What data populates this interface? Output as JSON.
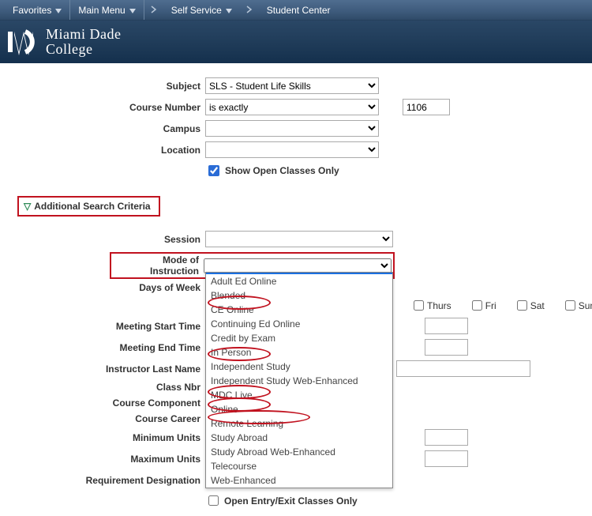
{
  "nav": {
    "favorites": "Favorites",
    "main_menu": "Main Menu",
    "self_service": "Self Service",
    "student_center": "Student Center"
  },
  "brand": {
    "line1": "Miami Dade",
    "line2": "College"
  },
  "form": {
    "subject_label": "Subject",
    "subject_value": "SLS - Student Life Skills",
    "course_number_label": "Course Number",
    "course_number_match": "is exactly",
    "course_number_value": "1106",
    "campus_label": "Campus",
    "campus_value": "",
    "location_label": "Location",
    "location_value": "",
    "show_open_label": "Show Open Classes Only"
  },
  "additional_label": "Additional Search Criteria",
  "adv": {
    "session_label": "Session",
    "moi_label": "Mode of Instruction",
    "days_label": "Days of Week",
    "meet_start_label": "Meeting Start Time",
    "meet_end_label": "Meeting End Time",
    "instructor_label": "Instructor Last Name",
    "class_nbr_label": "Class Nbr",
    "course_component_label": "Course Component",
    "course_career_label": "Course Career",
    "min_units_label": "Minimum Units",
    "max_units_label": "Maximum Units",
    "req_desig_label": "Requirement Designation",
    "open_entry_label": "Open Entry/Exit Classes Only"
  },
  "days": {
    "thurs": "Thurs",
    "fri": "Fri",
    "sat": "Sat",
    "sun": "Sun"
  },
  "moi_options": {
    "blank": "",
    "adult_ed": "Adult Ed Online",
    "blended": "Blended",
    "ce_online": "CE Online",
    "cont_ed": "Continuing Ed Online",
    "credit_exam": "Credit by Exam",
    "in_person": "In Person",
    "independent": "Independent Study",
    "independent_web": "Independent Study Web-Enhanced",
    "mdc_live": "MDC Live",
    "online": "Online",
    "remote": "Remote Learning",
    "study_abroad": "Study Abroad",
    "study_abroad_web": "Study Abroad Web-Enhanced",
    "telecourse": "Telecourse",
    "web_enhanced": "Web-Enhanced"
  }
}
